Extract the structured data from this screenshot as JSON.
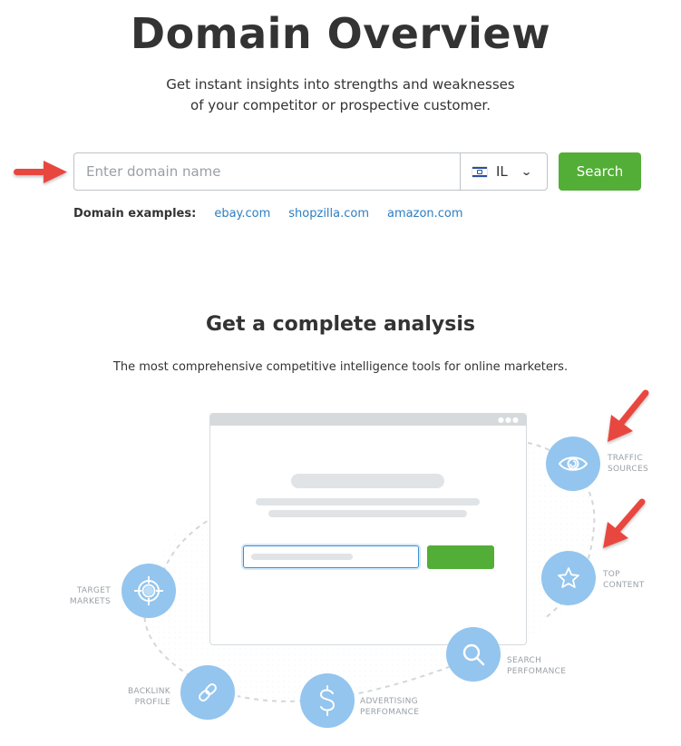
{
  "header": {
    "title": "Domain Overview",
    "subtitle_line1": "Get instant insights into strengths and weaknesses",
    "subtitle_line2": "of your competitor or prospective customer."
  },
  "search": {
    "placeholder": "Enter domain name",
    "value": "",
    "database": {
      "code": "IL",
      "flag": "israel-flag"
    },
    "button_label": "Search"
  },
  "examples": {
    "label": "Domain examples:",
    "links": [
      "ebay.com",
      "shopzilla.com",
      "amazon.com"
    ]
  },
  "analysis": {
    "title": "Get a complete analysis",
    "subtitle": "The most comprehensive competitive intelligence tools for online marketers.",
    "features": [
      {
        "icon": "eye-icon",
        "line1": "TRAFFIC",
        "line2": "SOURCES"
      },
      {
        "icon": "star-icon",
        "line1": "TOP",
        "line2": "CONTENT"
      },
      {
        "icon": "target-icon",
        "line1": "TARGET",
        "line2": "MARKETS"
      },
      {
        "icon": "link-icon",
        "line1": "BACKLINK",
        "line2": "PROFILE"
      },
      {
        "icon": "dollar-icon",
        "line1": "ADVERTISING",
        "line2": "PERFOMANCE"
      },
      {
        "icon": "search-icon",
        "line1": "SEARCH",
        "line2": "PERFOMANCE"
      }
    ]
  },
  "colors": {
    "accent_green": "#52ae37",
    "link_blue": "#2d7ec1",
    "node_blue": "#93c5ee",
    "annotation_red": "#e8473f"
  }
}
